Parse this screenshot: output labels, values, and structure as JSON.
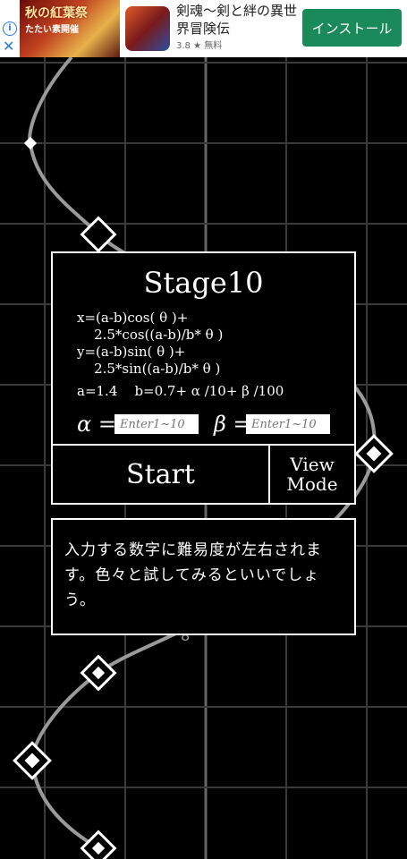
{
  "ad": {
    "banner_text": "秋の紅葉祭",
    "banner_subtext": "たたい素開催",
    "title": "剣魂～剣と絆の異世界冒険伝",
    "rating": "3.8",
    "price": "無料",
    "install_label": "インストール",
    "info_glyph": "i",
    "close_glyph": "✕"
  },
  "stage": {
    "title": "Stage10",
    "eq_x1": "x=(a-b)cos( θ )+",
    "eq_x2": "    2.5*cos((a-b)/b* θ )",
    "eq_y1": "y=(a-b)sin( θ )+",
    "eq_y2": "    2.5*sin((a-b)/b* θ )",
    "params": "a=1.4    b=0.7+ α /10+ β /100",
    "alpha_label": "α =",
    "beta_label": "β =",
    "alpha_placeholder": "Enter1~10",
    "beta_placeholder": "Enter1~10"
  },
  "buttons": {
    "start": "Start",
    "view_line1": "View",
    "view_line2": "Mode"
  },
  "message": "入力する数字に難易度が左右されます。色々と試してみるといいでしょう。",
  "colors": {
    "grid": "#3a3a3a",
    "curve": "#9a9a9a",
    "marker": "#ffffff",
    "install_button": "#1a8a5a"
  }
}
